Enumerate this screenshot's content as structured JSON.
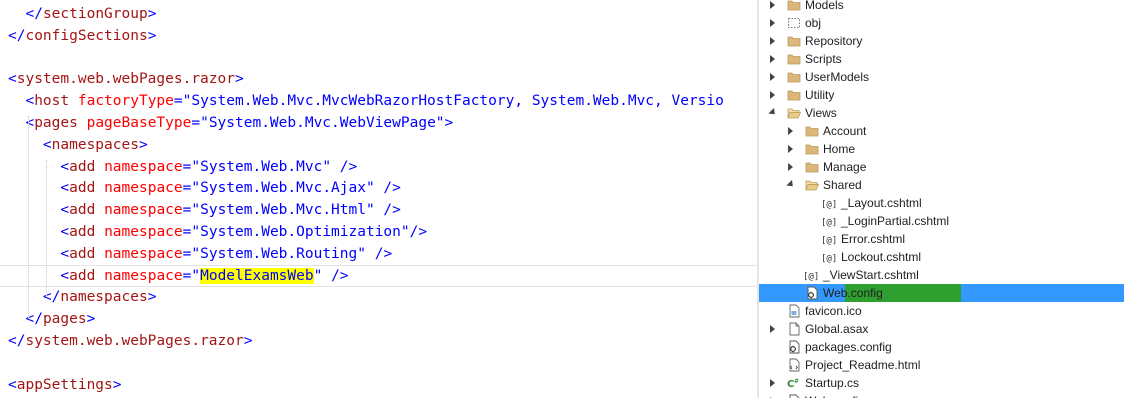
{
  "editor": {
    "lines": [
      {
        "indent": "  ",
        "tokens": [
          [
            "punc",
            "</"
          ],
          [
            "tag",
            "sectionGroup"
          ],
          [
            "punc",
            ">"
          ]
        ]
      },
      {
        "indent": "",
        "tokens": [
          [
            "punc",
            "</"
          ],
          [
            "tag",
            "configSections"
          ],
          [
            "punc",
            ">"
          ]
        ]
      },
      {
        "indent": "",
        "tokens": []
      },
      {
        "indent": "",
        "tokens": [
          [
            "punc",
            "<"
          ],
          [
            "tag",
            "system.web.webPages.razor"
          ],
          [
            "punc",
            ">"
          ]
        ]
      },
      {
        "indent": "  ",
        "tokens": [
          [
            "punc",
            "<"
          ],
          [
            "tag",
            "host"
          ],
          [
            "punc",
            " "
          ],
          [
            "attr",
            "factoryType"
          ],
          [
            "punc",
            "="
          ],
          [
            "val",
            "\"System.Web.Mvc.MvcWebRazorHostFactory, System.Web.Mvc, Versio"
          ]
        ]
      },
      {
        "indent": "  ",
        "tokens": [
          [
            "punc",
            "<"
          ],
          [
            "tag",
            "pages"
          ],
          [
            "punc",
            " "
          ],
          [
            "attr",
            "pageBaseType"
          ],
          [
            "punc",
            "="
          ],
          [
            "val",
            "\"System.Web.Mvc.WebViewPage\""
          ],
          [
            "punc",
            ">"
          ]
        ]
      },
      {
        "indent": "    ",
        "tokens": [
          [
            "punc",
            "<"
          ],
          [
            "tag",
            "namespaces"
          ],
          [
            "punc",
            ">"
          ]
        ]
      },
      {
        "indent": "      ",
        "tokens": [
          [
            "punc",
            "<"
          ],
          [
            "tag",
            "add"
          ],
          [
            "punc",
            " "
          ],
          [
            "attr",
            "namespace"
          ],
          [
            "punc",
            "="
          ],
          [
            "val",
            "\"System.Web.Mvc\""
          ],
          [
            "punc",
            " />"
          ]
        ]
      },
      {
        "indent": "      ",
        "tokens": [
          [
            "punc",
            "<"
          ],
          [
            "tag",
            "add"
          ],
          [
            "punc",
            " "
          ],
          [
            "attr",
            "namespace"
          ],
          [
            "punc",
            "="
          ],
          [
            "val",
            "\"System.Web.Mvc.Ajax\""
          ],
          [
            "punc",
            " />"
          ]
        ]
      },
      {
        "indent": "      ",
        "tokens": [
          [
            "punc",
            "<"
          ],
          [
            "tag",
            "add"
          ],
          [
            "punc",
            " "
          ],
          [
            "attr",
            "namespace"
          ],
          [
            "punc",
            "="
          ],
          [
            "val",
            "\"System.Web.Mvc.Html\""
          ],
          [
            "punc",
            " />"
          ]
        ]
      },
      {
        "indent": "      ",
        "tokens": [
          [
            "punc",
            "<"
          ],
          [
            "tag",
            "add"
          ],
          [
            "punc",
            " "
          ],
          [
            "attr",
            "namespace"
          ],
          [
            "punc",
            "="
          ],
          [
            "val",
            "\"System.Web.Optimization\""
          ],
          [
            "punc",
            "/>"
          ]
        ]
      },
      {
        "indent": "      ",
        "tokens": [
          [
            "punc",
            "<"
          ],
          [
            "tag",
            "add"
          ],
          [
            "punc",
            " "
          ],
          [
            "attr",
            "namespace"
          ],
          [
            "punc",
            "="
          ],
          [
            "val",
            "\"System.Web.Routing\""
          ],
          [
            "punc",
            " />"
          ]
        ]
      },
      {
        "indent": "      ",
        "current": true,
        "tokens": [
          [
            "punc",
            "<"
          ],
          [
            "tag",
            "add"
          ],
          [
            "punc",
            " "
          ],
          [
            "attr",
            "namespace"
          ],
          [
            "punc",
            "="
          ],
          [
            "val",
            "\""
          ],
          [
            "hl",
            "ModelExamsWeb"
          ],
          [
            "val",
            "\""
          ],
          [
            "punc",
            " />"
          ]
        ]
      },
      {
        "indent": "    ",
        "tokens": [
          [
            "punc",
            "</"
          ],
          [
            "tag",
            "namespaces"
          ],
          [
            "punc",
            ">"
          ]
        ]
      },
      {
        "indent": "  ",
        "tokens": [
          [
            "punc",
            "</"
          ],
          [
            "tag",
            "pages"
          ],
          [
            "punc",
            ">"
          ]
        ]
      },
      {
        "indent": "",
        "tokens": [
          [
            "punc",
            "</"
          ],
          [
            "tag",
            "system.web.webPages.razor"
          ],
          [
            "punc",
            ">"
          ]
        ]
      },
      {
        "indent": "",
        "tokens": []
      },
      {
        "indent": "",
        "tokens": [
          [
            "punc",
            "<"
          ],
          [
            "tag",
            "appSettings"
          ],
          [
            "punc",
            ">"
          ]
        ]
      }
    ]
  },
  "explorer": {
    "items": [
      {
        "label": "Models",
        "icon": "folder-icon",
        "arrow": "collapsed",
        "depth": 0
      },
      {
        "label": "obj",
        "icon": "dotted-folder-icon",
        "arrow": "collapsed",
        "depth": 0
      },
      {
        "label": "Repository",
        "icon": "folder-icon",
        "arrow": "collapsed",
        "depth": 0
      },
      {
        "label": "Scripts",
        "icon": "folder-icon",
        "arrow": "collapsed",
        "depth": 0
      },
      {
        "label": "UserModels",
        "icon": "folder-icon",
        "arrow": "collapsed",
        "depth": 0
      },
      {
        "label": "Utility",
        "icon": "folder-icon",
        "arrow": "collapsed",
        "depth": 0
      },
      {
        "label": "Views",
        "icon": "open-folder-icon",
        "arrow": "expanded",
        "depth": 0
      },
      {
        "label": "Account",
        "icon": "folder-icon",
        "arrow": "collapsed",
        "depth": 1
      },
      {
        "label": "Home",
        "icon": "folder-icon",
        "arrow": "collapsed",
        "depth": 1
      },
      {
        "label": "Manage",
        "icon": "folder-icon",
        "arrow": "collapsed",
        "depth": 1
      },
      {
        "label": "Shared",
        "icon": "open-folder-icon",
        "arrow": "expanded",
        "depth": 1
      },
      {
        "label": "_Layout.cshtml",
        "icon": "razor-file-icon",
        "arrow": "none",
        "depth": 2
      },
      {
        "label": "_LoginPartial.cshtml",
        "icon": "razor-file-icon",
        "arrow": "none",
        "depth": 2
      },
      {
        "label": "Error.cshtml",
        "icon": "razor-file-icon",
        "arrow": "none",
        "depth": 2
      },
      {
        "label": "Lockout.cshtml",
        "icon": "razor-file-icon",
        "arrow": "none",
        "depth": 2
      },
      {
        "label": "_ViewStart.cshtml",
        "icon": "razor-file-icon",
        "arrow": "none",
        "depth": 1
      },
      {
        "label": "Web.config",
        "icon": "config-file-icon",
        "arrow": "none",
        "depth": 1,
        "selected": true
      },
      {
        "label": "favicon.ico",
        "icon": "image-file-icon",
        "arrow": "none",
        "depth": 0
      },
      {
        "label": "Global.asax",
        "icon": "file-icon",
        "arrow": "collapsed",
        "depth": 0
      },
      {
        "label": "packages.config",
        "icon": "config-file-icon",
        "arrow": "none",
        "depth": 0
      },
      {
        "label": "Project_Readme.html",
        "icon": "html-file-icon",
        "arrow": "none",
        "depth": 0
      },
      {
        "label": "Startup.cs",
        "icon": "csharp-file-icon",
        "arrow": "collapsed",
        "depth": 0
      },
      {
        "label": "Web.config",
        "icon": "config-file-icon",
        "arrow": "collapsed",
        "depth": 0
      }
    ],
    "colors": {
      "selected_row": "#3399ff",
      "highlight_green": "#2fa02f",
      "folder": "#dcb67a"
    }
  }
}
